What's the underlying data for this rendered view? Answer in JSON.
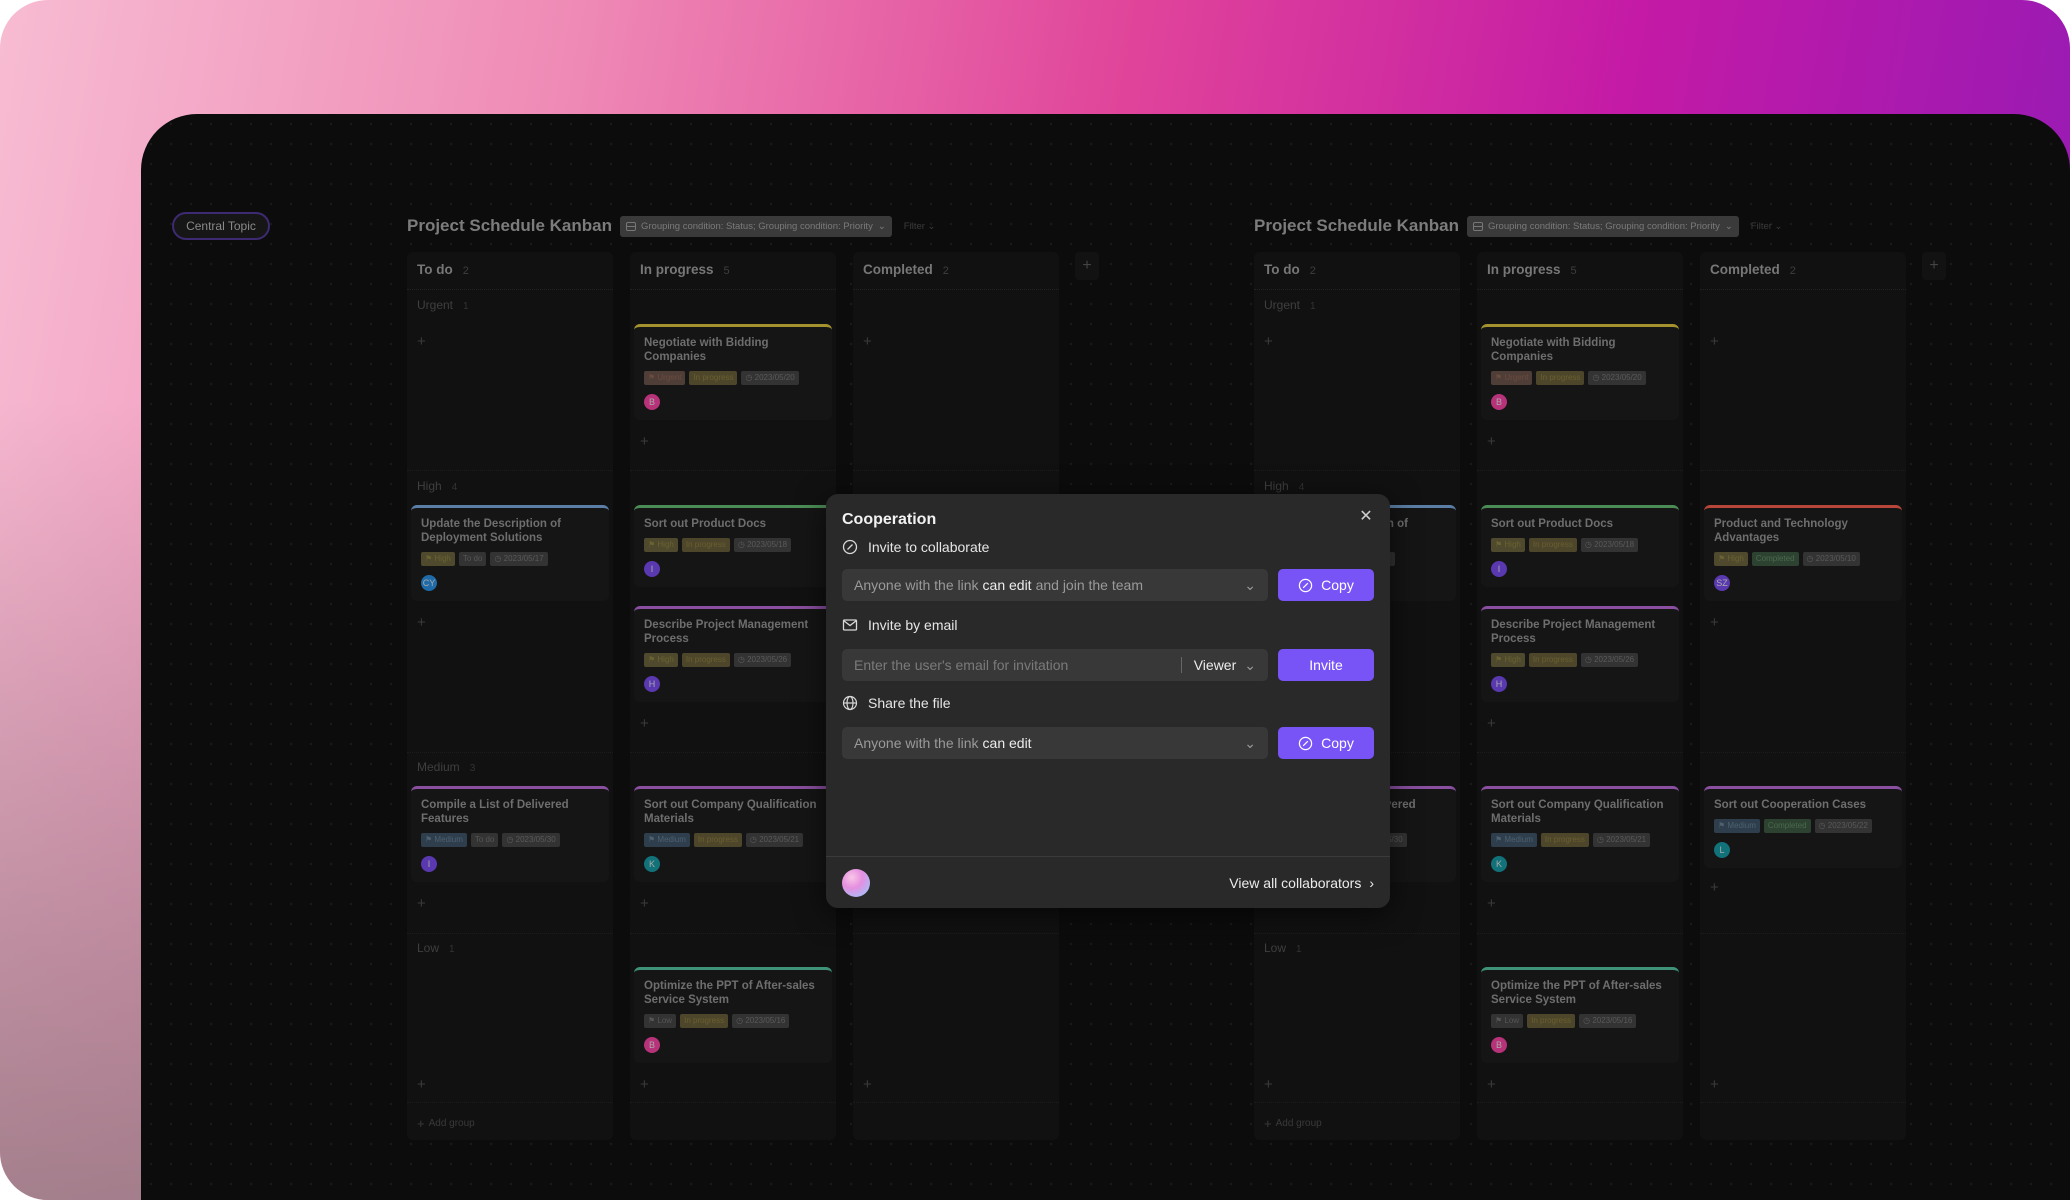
{
  "canvas": {
    "central_topic": "Central Topic"
  },
  "boards": [
    {
      "title": "Project Schedule Kanban",
      "grouping": "Grouping condition: Status; Grouping condition: Priority",
      "filter": "Filter",
      "add_group": "Add group",
      "columns": [
        {
          "title": "To do",
          "count": "2"
        },
        {
          "title": "In progress",
          "count": "5"
        },
        {
          "title": "Completed",
          "count": "2"
        }
      ],
      "groups": [
        {
          "name": "Urgent",
          "count": "1"
        },
        {
          "name": "High",
          "count": "4"
        },
        {
          "name": "Medium",
          "count": "3"
        },
        {
          "name": "Low",
          "count": "1"
        }
      ]
    },
    {
      "title": "Project Schedule Kanban",
      "grouping": "Grouping condition: Status; Grouping condition: Priority",
      "filter": "Filter",
      "add_group": "Add group",
      "columns": [
        {
          "title": "To do",
          "count": "2"
        },
        {
          "title": "In progress",
          "count": "5"
        },
        {
          "title": "Completed",
          "count": "2"
        }
      ],
      "groups": [
        {
          "name": "Urgent",
          "count": "1"
        },
        {
          "name": "High",
          "count": "4"
        },
        {
          "name": "Medium",
          "count": "3"
        },
        {
          "name": "Low",
          "count": "1"
        }
      ]
    }
  ],
  "cards": [
    {
      "title": "Negotiate with Bidding Companies",
      "priority": "Urgent",
      "status": "In progress",
      "date": "2023/05/20",
      "assignee": "B",
      "avatar_color": "#b8327a",
      "accent": "#a4922e"
    },
    {
      "title": "Update the Description of Deployment Solutions",
      "priority": "High",
      "status": "To do",
      "date": "2023/05/17",
      "assignee": "CY",
      "avatar_color": "#1f6aa8",
      "accent": "#5a7ea5"
    },
    {
      "title": "Sort out Product Docs",
      "priority": "High",
      "status": "In progress",
      "date": "2023/05/18",
      "assignee": "I",
      "avatar_color": "#5a38b0",
      "accent": "#4c8d57"
    },
    {
      "title": "Describe Project Management Process",
      "priority": "High",
      "status": "In progress",
      "date": "2023/05/26",
      "assignee": "H",
      "avatar_color": "#5a38b0",
      "accent": "#8a4fa0"
    },
    {
      "title": "Product and Technology Advantages",
      "priority": "High",
      "status": "Completed",
      "date": "2023/05/10",
      "assignee": "SZ",
      "avatar_color": "#5a38b0",
      "accent": "#b8453a"
    },
    {
      "title": "Compile a List of Delivered Features",
      "priority": "Medium",
      "status": "To do",
      "date": "2023/05/30",
      "assignee": "I",
      "avatar_color": "#5a38b0",
      "accent": "#8a4fa0"
    },
    {
      "title": "Sort out Company Qualification Materials",
      "priority": "Medium",
      "status": "In progress",
      "date": "2023/05/21",
      "assignee": "K",
      "avatar_color": "#12727a",
      "accent": "#8a4fa0"
    },
    {
      "title": "Sort out Cooperation Cases",
      "priority": "Medium",
      "status": "Completed",
      "date": "2023/05/22",
      "assignee": "L",
      "avatar_color": "#12727a",
      "accent": "#8a4fa0"
    },
    {
      "title": "Optimize the PPT of After-sales Service System",
      "priority": "Low",
      "status": "In progress",
      "date": "2023/05/16",
      "assignee": "B",
      "avatar_color": "#b8327a",
      "accent": "#3f9278"
    }
  ],
  "dialog": {
    "title": "Cooperation",
    "close_icon": "close-icon",
    "invite_section": {
      "label": "Invite to collaborate",
      "icon": "link-icon",
      "link_prefix": "Anyone with the link",
      "link_permission": "can edit",
      "link_suffix": "and join the team",
      "copy_label": "Copy"
    },
    "email_section": {
      "label": "Invite by email",
      "icon": "mail-icon",
      "placeholder": "Enter the user's email for invitation",
      "value": "",
      "role": "Viewer",
      "invite_label": "Invite"
    },
    "share_section": {
      "label": "Share the file",
      "icon": "globe-icon",
      "link_prefix": "Anyone with the link",
      "link_permission": "can edit",
      "copy_label": "Copy"
    },
    "footer": {
      "view_all_label": "View all collaborators"
    },
    "accent": "#7854f7"
  }
}
